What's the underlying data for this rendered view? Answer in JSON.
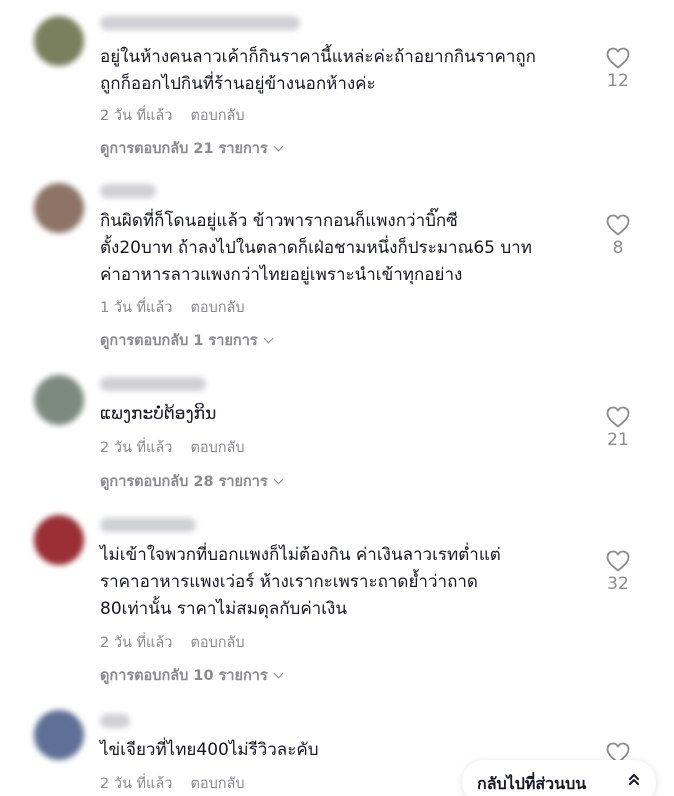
{
  "comments": [
    {
      "lines": [
        "อยู่ในห้างคนลาวเค้าก็กินราคานี้แหล่ะค่ะถ้าอยากกินราคาถูก",
        "ถูกก็ออกไปกินที่ร้านอยู่ข้างนอกห้างค่ะ"
      ],
      "time": "2 วัน ที่แล้ว",
      "reply": "ตอบกลับ",
      "view_replies": "ดูการตอบกลับ 21 รายการ",
      "likes": "12",
      "avatar_color": "#7a7f5e"
    },
    {
      "lines": [
        "กินผิดที่ก็โดนอยู่แล้ว ข้าวพารากอนก็แพงกว่าบิ๊กซี",
        "ตั้ง20บาท ถ้าลงไปในตลาดก็เฝ่อชามหนึ่งก็ประมาณ65 บาท",
        "ค่าอาหารลาวแพงกว่าไทยอยู่เพราะนำเข้าทุกอย่าง"
      ],
      "time": "1 วัน ที่แล้ว",
      "reply": "ตอบกลับ",
      "view_replies": "ดูการตอบกลับ 1 รายการ",
      "likes": "8",
      "avatar_color": "#8d7466"
    },
    {
      "lines": [
        "ແພງກະບໍ່ຕ້ອງກິນ"
      ],
      "time": "2 วัน ที่แล้ว",
      "reply": "ตอบกลับ",
      "view_replies": "ดูการตอบกลับ 28 รายการ",
      "likes": "21",
      "avatar_color": "#7d8a80"
    },
    {
      "lines": [
        "ไม่เข้าใจพวกที่บอกแพงก็ไม่ต้องกิน ค่าเงินลาวเรทต่ำแต่",
        "ราคาอาหารแพงเว่อร์ ห้างเรากะเพราะถาดย้ำว่าถาด",
        "80เท่านั้น ราคาไม่สมดุลกับค่าเงิน"
      ],
      "time": "2 วัน ที่แล้ว",
      "reply": "ตอบกลับ",
      "view_replies": "ดูการตอบกลับ 10 รายการ",
      "likes": "32",
      "avatar_color": "#9a2f35"
    },
    {
      "lines": [
        "ไข่เจียวที่ไทย400ไม่รีวิวละคับ"
      ],
      "time": "2 วัน ที่แล้ว",
      "reply": "ตอบกลับ",
      "likes": "",
      "avatar_color": "#5f7096"
    }
  ],
  "back_to_top": "กลับไปที่ส่วนบน",
  "colors": {
    "text": "#161823",
    "secondary": "#8a8b91",
    "background": "#ffffff"
  },
  "icons": {
    "like": "heart-outline-icon",
    "expand": "chevron-down-icon",
    "back_to_top": "double-chevron-up-icon"
  }
}
